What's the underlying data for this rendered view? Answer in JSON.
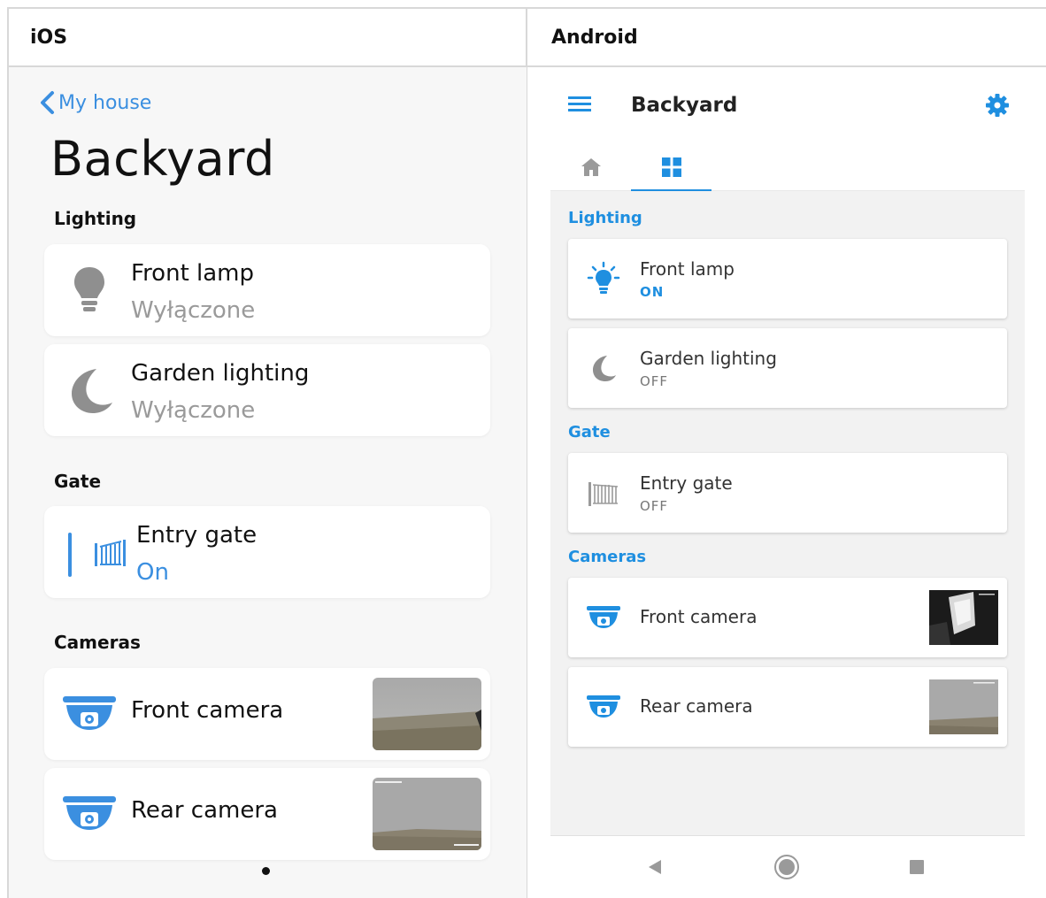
{
  "columns": {
    "ios": "iOS",
    "android": "Android"
  },
  "ios": {
    "back_label": "My house",
    "title": "Backyard",
    "sections": {
      "lighting": "Lighting",
      "gate": "Gate",
      "cameras": "Cameras"
    },
    "items": {
      "front_lamp": {
        "name": "Front lamp",
        "status": "Wyłączone",
        "icon": "lightbulb-icon"
      },
      "garden_lighting": {
        "name": "Garden lighting",
        "status": "Wyłączone",
        "icon": "moon-icon"
      },
      "entry_gate": {
        "name": "Entry gate",
        "status": "On",
        "icon": "gate-icon"
      },
      "front_camera": {
        "name": "Front camera",
        "icon": "camera-icon"
      },
      "rear_camera": {
        "name": "Rear camera",
        "icon": "camera-icon"
      }
    }
  },
  "android": {
    "title": "Backyard",
    "sections": {
      "lighting": "Lighting",
      "gate": "Gate",
      "cameras": "Cameras"
    },
    "tabs": [
      {
        "icon": "home-icon",
        "active": false
      },
      {
        "icon": "grid-icon",
        "active": true
      }
    ],
    "items": {
      "front_lamp": {
        "name": "Front lamp",
        "status": "ON",
        "icon": "lightbulb-on-icon"
      },
      "garden_lighting": {
        "name": "Garden lighting",
        "status": "OFF",
        "icon": "moon-icon"
      },
      "entry_gate": {
        "name": "Entry gate",
        "status": "OFF",
        "icon": "gate-icon"
      },
      "front_camera": {
        "name": "Front camera",
        "icon": "camera-icon"
      },
      "rear_camera": {
        "name": "Rear camera",
        "icon": "camera-icon"
      }
    },
    "nav": [
      "back-icon",
      "home-circle-icon",
      "recents-icon"
    ]
  },
  "colors": {
    "accent_blue": "#3b8fe0",
    "android_blue": "#1f8fe0",
    "muted_gray": "#9a9a9a",
    "icon_gray": "#8f8f8f"
  }
}
